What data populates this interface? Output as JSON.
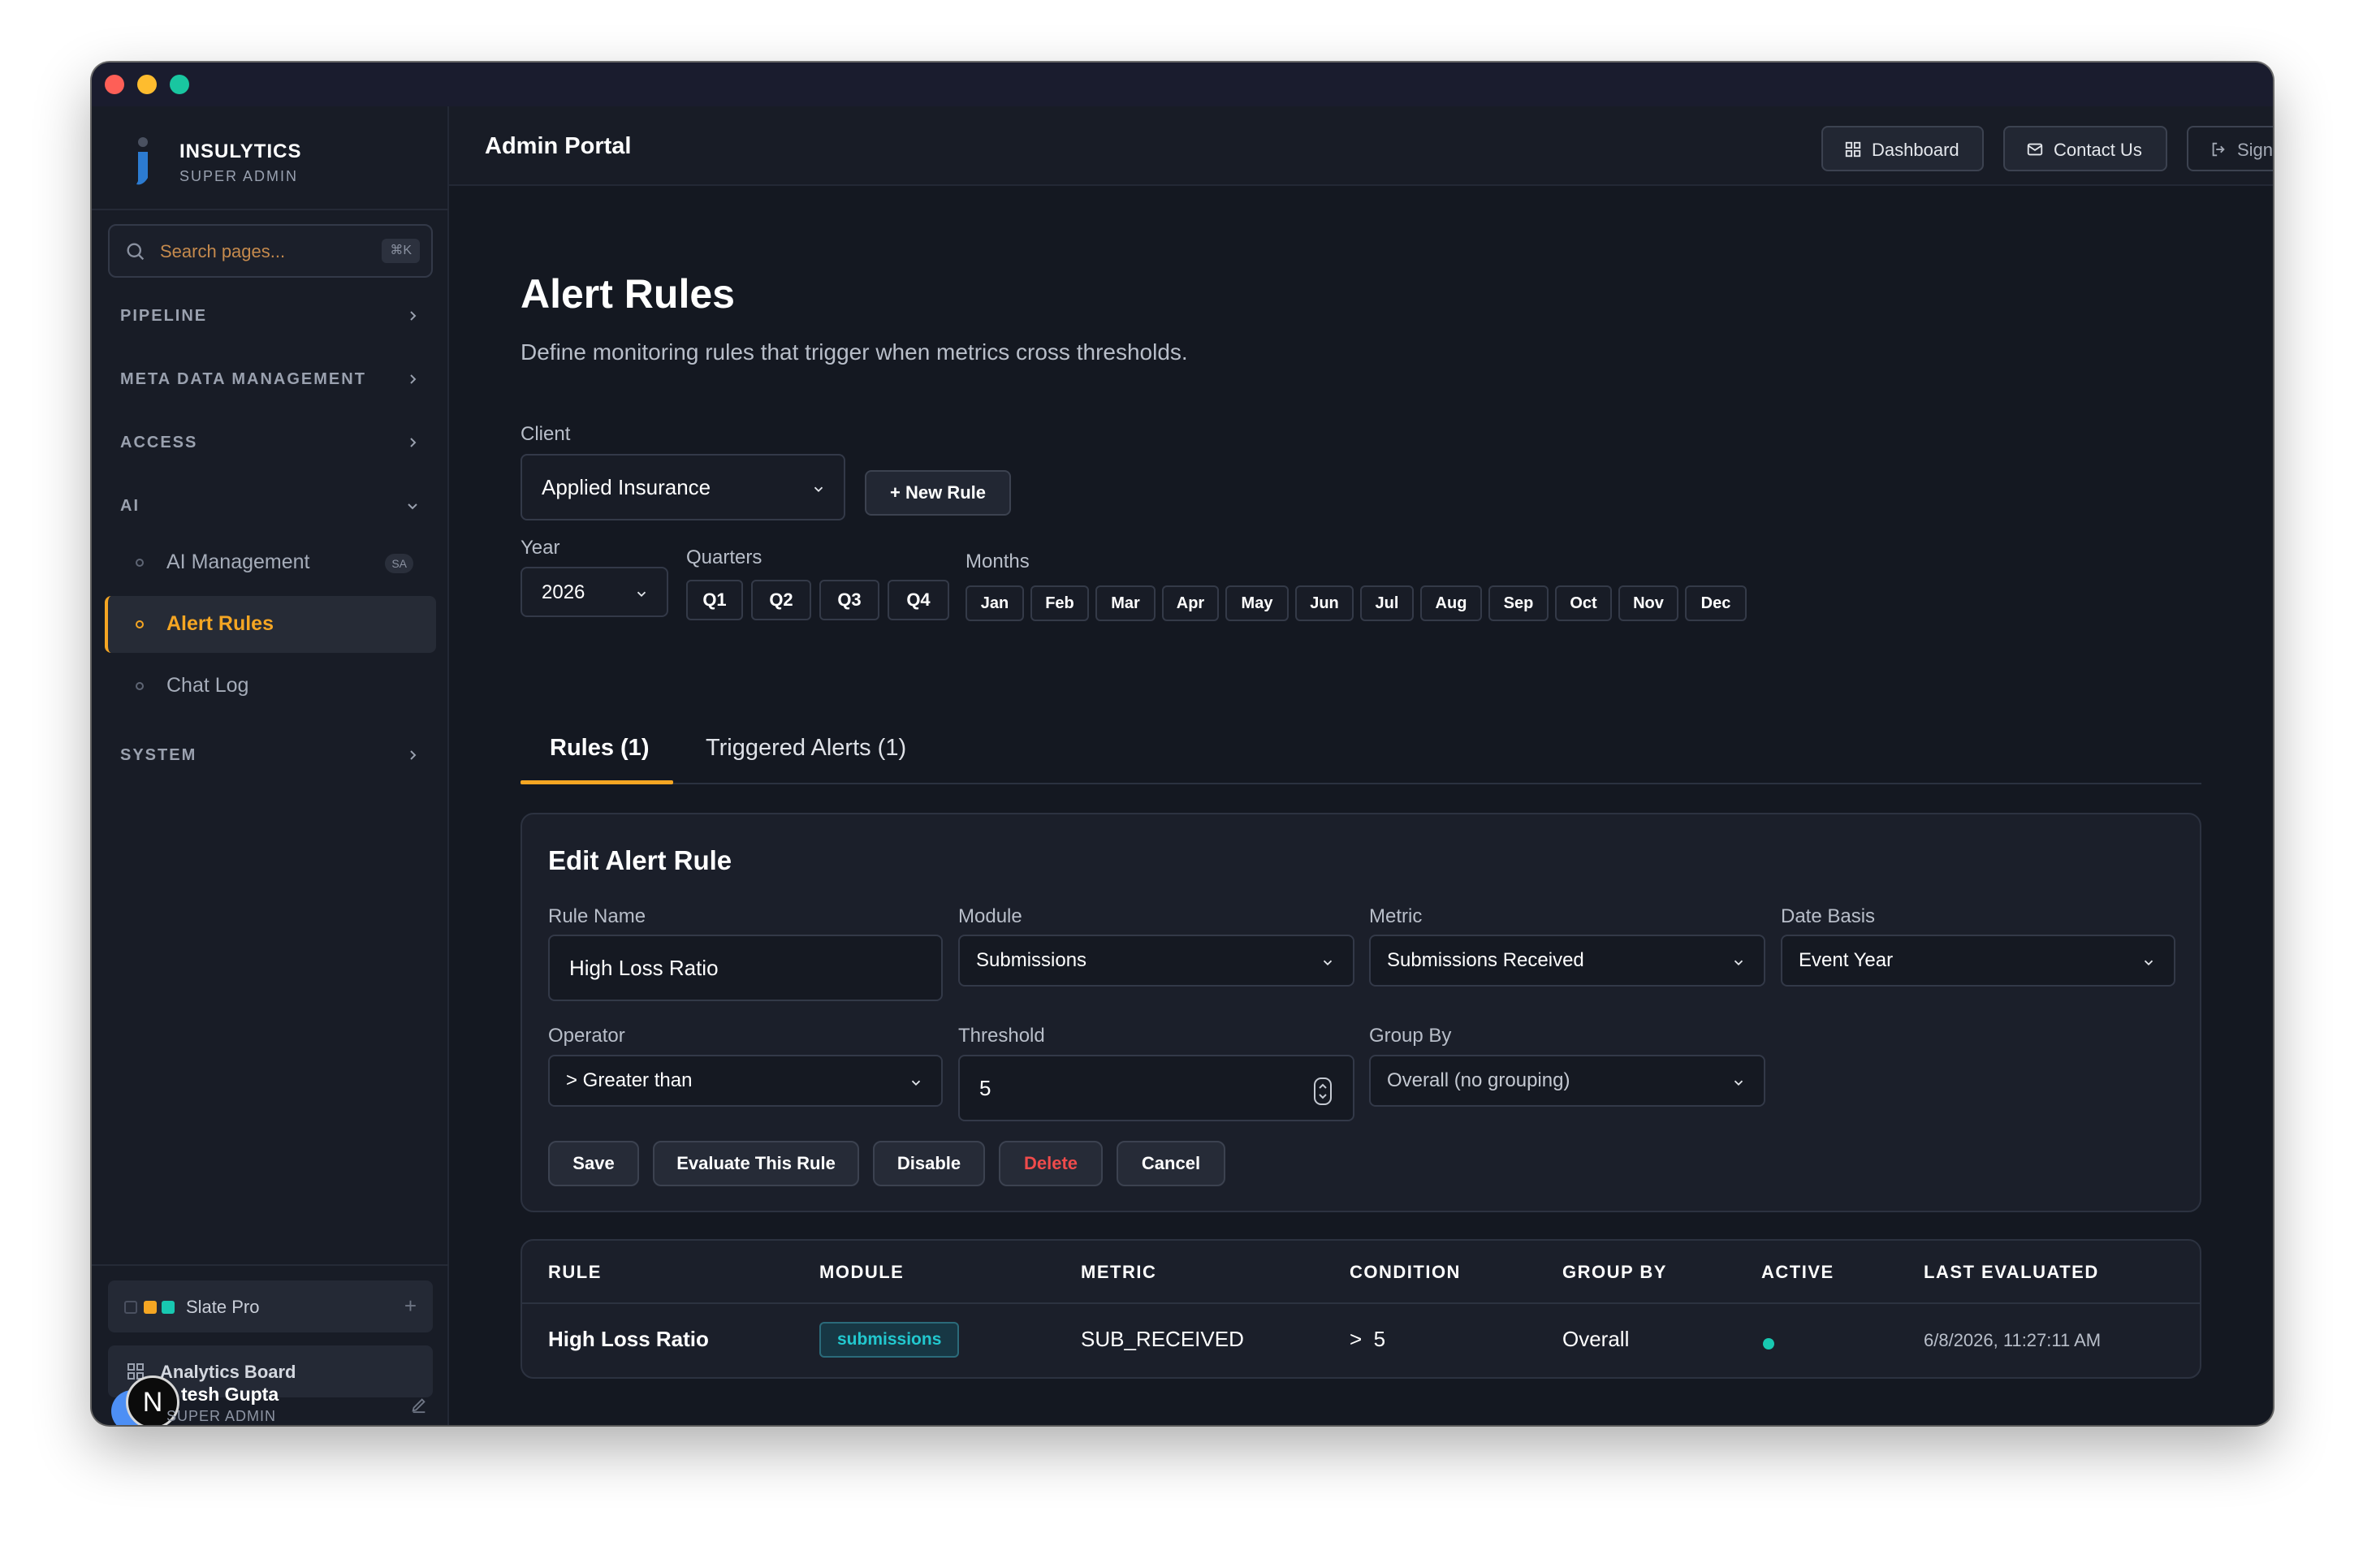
{
  "brand": {
    "name": "INSULYTICS",
    "subtitle": "SUPER ADMIN"
  },
  "search": {
    "placeholder": "Search pages...",
    "shortcut": "⌘K"
  },
  "nav": {
    "sections": [
      {
        "label": "PIPELINE"
      },
      {
        "label": "META DATA MANAGEMENT"
      },
      {
        "label": "ACCESS"
      },
      {
        "label": "AI"
      },
      {
        "label": "SYSTEM"
      }
    ],
    "ai_items": [
      {
        "label": "AI Management",
        "badge": "SA"
      },
      {
        "label": "Alert Rules"
      },
      {
        "label": "Chat Log"
      }
    ]
  },
  "sidebar_footer": {
    "plan_label": "Slate Pro",
    "plan_colors": [
      "#242935",
      "#f5a623",
      "#18c8b1"
    ],
    "board_label": "Analytics Board",
    "user_initial": "N",
    "user_name": "tesh Gupta",
    "user_role": "SUPER ADMIN"
  },
  "header": {
    "title": "Admin Portal",
    "dashboard_label": "Dashboard",
    "contact_label": "Contact Us",
    "signout_label": "Sign Out"
  },
  "page": {
    "title": "Alert Rules",
    "description": "Define monitoring rules that trigger when metrics cross thresholds."
  },
  "filters": {
    "client_label": "Client",
    "client_value": "Applied Insurance",
    "new_rule_label": "+ New Rule",
    "year_label": "Year",
    "year_value": "2026",
    "quarters_label": "Quarters",
    "quarters": [
      "Q1",
      "Q2",
      "Q3",
      "Q4"
    ],
    "months_label": "Months",
    "months": [
      "Jan",
      "Feb",
      "Mar",
      "Apr",
      "May",
      "Jun",
      "Jul",
      "Aug",
      "Sep",
      "Oct",
      "Nov",
      "Dec"
    ]
  },
  "tabs": [
    {
      "label": "Rules (1)"
    },
    {
      "label": "Triggered Alerts (1)"
    }
  ],
  "edit_form": {
    "title": "Edit Alert Rule",
    "rule_name_label": "Rule Name",
    "rule_name_value": "High Loss Ratio",
    "module_label": "Module",
    "module_value": "Submissions",
    "metric_label": "Metric",
    "metric_value": "Submissions Received",
    "date_basis_label": "Date Basis",
    "date_basis_value": "Event Year",
    "operator_label": "Operator",
    "operator_value": "> Greater than",
    "threshold_label": "Threshold",
    "threshold_value": "5",
    "group_by_label": "Group By",
    "group_by_value": "Overall (no grouping)",
    "buttons": {
      "save": "Save",
      "evaluate": "Evaluate This Rule",
      "disable": "Disable",
      "delete": "Delete",
      "cancel": "Cancel"
    }
  },
  "table": {
    "headers": [
      "RULE",
      "MODULE",
      "METRIC",
      "CONDITION",
      "GROUP BY",
      "ACTIVE",
      "LAST EVALUATED"
    ],
    "rows": [
      {
        "rule": "High Loss Ratio",
        "module": "submissions",
        "metric": "SUB_RECEIVED",
        "condition": ">  5",
        "group_by": "Overall",
        "active": true,
        "last_evaluated": "6/8/2026, 11:27:11 AM"
      }
    ]
  },
  "colors": {
    "accent": "#f5a623",
    "active_status": "#18c8b1",
    "danger": "#ef4b4b",
    "module_tag": "#22c8cf"
  }
}
